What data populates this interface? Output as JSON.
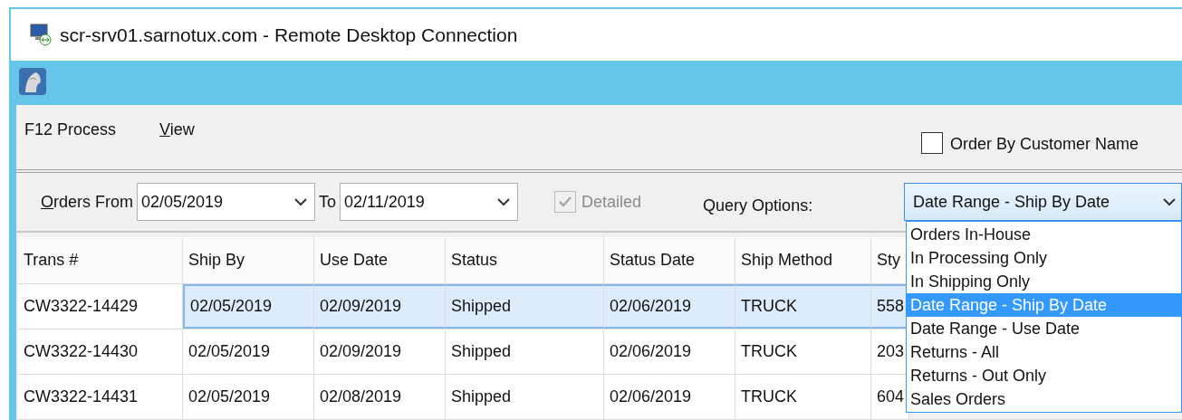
{
  "window": {
    "title": "scr-srv01.sarnotux.com - Remote Desktop Connection"
  },
  "menu": [
    {
      "label": "F12 Process",
      "underline_first": false
    },
    {
      "label": "View",
      "underline_first": true
    }
  ],
  "order_by_customer_name": {
    "label": "Order By Customer Name",
    "checked": false
  },
  "filter": {
    "from_label": "Orders From",
    "from_underline_first": true,
    "from_value": "02/05/2019",
    "to_label": "To",
    "to_value": "02/11/2019",
    "detailed": {
      "label": "Detailed",
      "checked": true,
      "disabled": true
    },
    "query_label": "Query Options:",
    "query_value": "Date Range - Ship By Date",
    "query_expanded": true,
    "query_options": [
      {
        "label": "Orders In-House",
        "selected": false
      },
      {
        "label": "In Processing Only",
        "selected": false
      },
      {
        "label": "In Shipping Only",
        "selected": false
      },
      {
        "label": "Date Range - Ship By Date",
        "selected": true
      },
      {
        "label": "Date Range - Use Date",
        "selected": false
      },
      {
        "label": "Returns - All",
        "selected": false
      },
      {
        "label": "Returns - Out Only",
        "selected": false
      },
      {
        "label": "Sales Orders",
        "selected": false
      }
    ]
  },
  "table": {
    "columns": [
      "Trans #",
      "Ship By",
      "Use Date",
      "Status",
      "Status Date",
      "Ship Method",
      "Sty"
    ],
    "rows": [
      {
        "cells": [
          "CW3322-14429",
          "02/05/2019",
          "02/09/2019",
          "Shipped",
          "02/06/2019",
          "TRUCK",
          "558"
        ],
        "selected": true
      },
      {
        "cells": [
          "CW3322-14430",
          "02/05/2019",
          "02/09/2019",
          "Shipped",
          "02/06/2019",
          "TRUCK",
          "203"
        ],
        "selected": false
      },
      {
        "cells": [
          "CW3322-14431",
          "02/05/2019",
          "02/08/2019",
          "Shipped",
          "02/06/2019",
          "TRUCK",
          "604"
        ],
        "selected": false
      }
    ]
  }
}
